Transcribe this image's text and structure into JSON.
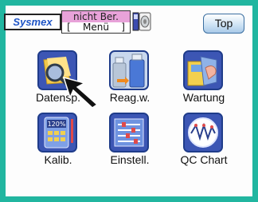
{
  "header": {
    "logo_text": "Sysmex",
    "status_top": "nicht Ber.",
    "status_bottom": "[    Menü    ]",
    "top_button": "Top"
  },
  "menu": {
    "items": [
      {
        "label": "Datensp.",
        "icon": "data-browser-icon"
      },
      {
        "label": "Reag.w.",
        "icon": "reagent-bottles-icon"
      },
      {
        "label": "Wartung",
        "icon": "maintenance-icon"
      },
      {
        "label": "Kalib.",
        "icon": "calibration-icon"
      },
      {
        "label": "Einstell.",
        "icon": "settings-list-icon"
      },
      {
        "label": "QC Chart",
        "icon": "qc-chart-icon"
      }
    ]
  },
  "colors": {
    "frame": "#21b6a0",
    "tile": "#3c56b4",
    "status_highlight": "#e8a2d9"
  }
}
